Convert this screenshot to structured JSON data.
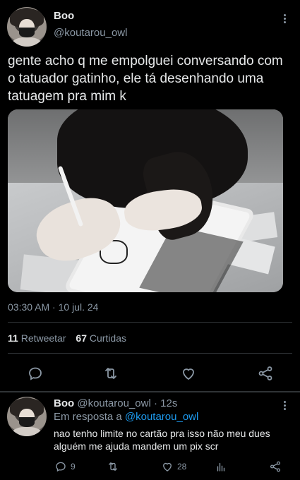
{
  "tweet": {
    "author_name": "Boo",
    "author_handle": "@koutarou_owl",
    "text": "gente acho q me empolguei conversando com o tatuador gatinho, ele tá desenhando uma tatuagem pra mim k",
    "time": "03:30 AM",
    "date_sep": " · ",
    "date": "10 jul. 24",
    "retweet_count": "11",
    "retweet_label": "Retweetar",
    "like_count": "67",
    "like_label": "Curtidas",
    "icons": [
      "more-icon",
      "reply-icon",
      "retweet-icon",
      "like-icon",
      "share-icon"
    ]
  },
  "reply": {
    "author_name": "Boo",
    "author_handle": "@koutarou_owl",
    "age": "· 12s",
    "reply_prefix": "Em resposta a",
    "reply_to": "@koutarou_owl",
    "text": "nao tenho limite no cartão pra isso não meu dues alguém me ajuda mandem um pix scr",
    "reply_count": "9",
    "retweet_count": "",
    "like_count": "28",
    "icons": [
      "reply-icon",
      "retweet-icon",
      "like-icon",
      "views-icon",
      "share-icon"
    ]
  },
  "colors": {
    "background": "#000000",
    "text": "#e7e9ea",
    "secondary": "#8b98a5",
    "link": "#1d9bf0",
    "divider": "#2f3336"
  }
}
